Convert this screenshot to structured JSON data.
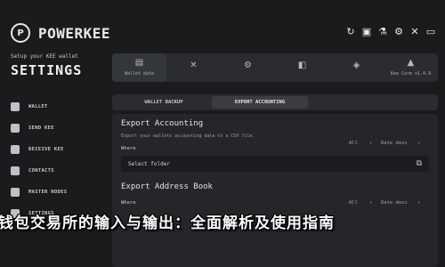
{
  "header": {
    "logo_mark": "P",
    "app_name": "POWERKEE",
    "icons": [
      "sync-icon",
      "gift-icon",
      "flask-icon",
      "settings-icon",
      "close-icon",
      "minimize-icon"
    ],
    "icon_glyphs": [
      "↻",
      "▣",
      "⚗",
      "⚙",
      "✕",
      "▭"
    ]
  },
  "sidebar": {
    "subtitle": "Setup your KEE wallet",
    "title": "SETTINGS",
    "items": [
      {
        "label": "WALLET",
        "icon": "wallet-icon"
      },
      {
        "label": "SEND KEE",
        "icon": "send-icon"
      },
      {
        "label": "RECEIVE KEE",
        "icon": "receive-icon"
      },
      {
        "label": "CONTACTS",
        "icon": "contacts-icon"
      },
      {
        "label": "MASTER NODES",
        "icon": "masternodes-icon"
      },
      {
        "label": "SETTINGS",
        "icon": "settings-icon"
      }
    ]
  },
  "tiles": [
    {
      "label": "Wallet data",
      "glyph": "▤"
    },
    {
      "label": "",
      "glyph": "✕"
    },
    {
      "label": "",
      "glyph": "⚙"
    },
    {
      "label": "",
      "glyph": "◧"
    },
    {
      "label": "",
      "glyph": "◈"
    },
    {
      "label": "Kee Core v1.4.9",
      "glyph": "▲"
    }
  ],
  "subtabs": {
    "wallet_backup": "WALLET BACKUP",
    "export_accounting": "EXPORT ACCOUNTING"
  },
  "export_accounting": {
    "title": "Export Accounting",
    "desc": "Export your wallets accounting data to a CSV file.",
    "where": "Where",
    "filter": "All",
    "sort": "Date desc",
    "folder_placeholder": "Select folder"
  },
  "export_address_book": {
    "title": "Export Address Book",
    "where": "Where",
    "filter": "All",
    "sort": "Date desc"
  },
  "caption": "钱包交易所的输入与输出：全面解析及使用指南"
}
